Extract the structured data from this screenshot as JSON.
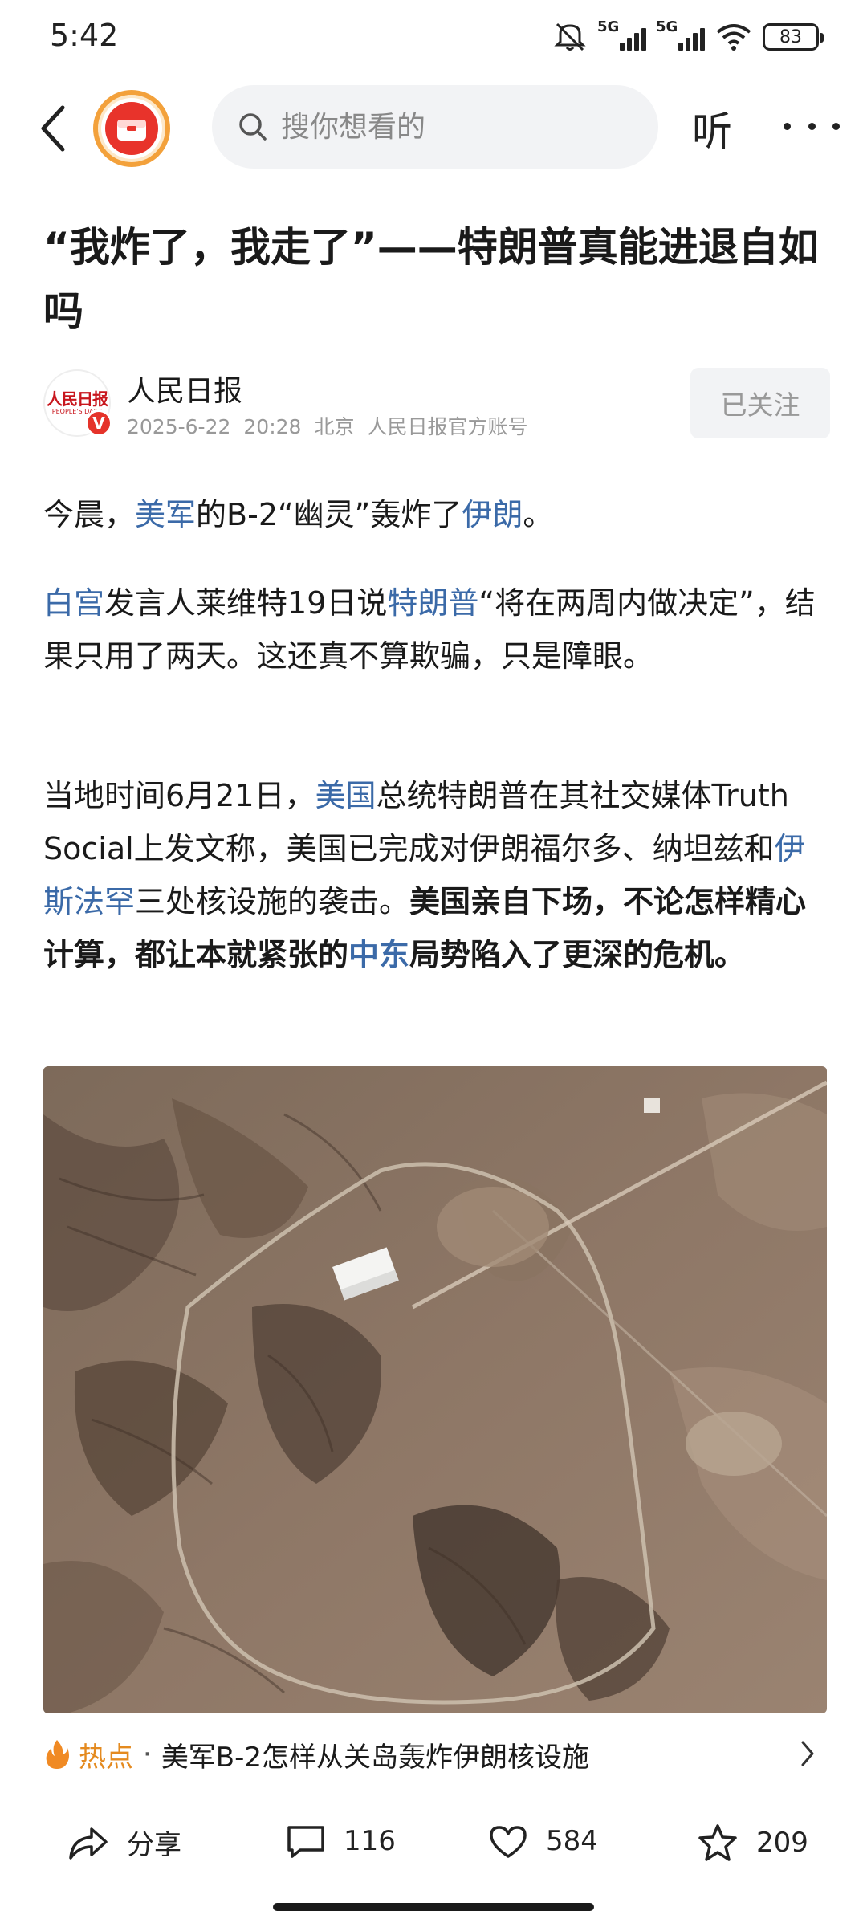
{
  "status_bar": {
    "time": "5:42",
    "network_1": "5G",
    "network_2": "5G",
    "battery": "83",
    "icons": [
      "mute-icon",
      "signal-icon",
      "signal-icon",
      "wifi-icon",
      "battery-icon"
    ]
  },
  "nav": {
    "search_placeholder": "搜你想看的",
    "listen_label": "听",
    "icons": [
      "back-icon",
      "app-logo",
      "search-icon",
      "more-icon"
    ]
  },
  "article": {
    "title": "“我炸了，我走了”——特朗普真能进退自如吗",
    "author": {
      "name": "人民日报",
      "date": "2025-6-22",
      "time": "20:28",
      "location": "北京",
      "account_type": "人民日报官方账号",
      "avatar_logo": "人民日报",
      "avatar_sub": "PEOPLE'S DAILY",
      "badge": "V",
      "follow_label": "已关注"
    },
    "p1": {
      "t1": "今晨，",
      "l1": "美军",
      "t2": "的B-2“幽灵”轰炸了",
      "l2": "伊朗",
      "t3": "。"
    },
    "p2": {
      "l1": "白宫",
      "t1": "发言人莱维特19日说",
      "l2": "特朗普",
      "t2": "“将在两周内做决定”，结果只用了两天。这还真不算欺骗，只是障眼。"
    },
    "p3": {
      "t1": "当地时间6月21日，",
      "l1": "美国",
      "t2": "总统特朗普在其社交媒体Truth Social上发文称，美国已完成对伊朗福尔多、纳坦兹和",
      "l2": "伊斯法罕",
      "t3": "三处核设施的袭击。",
      "b1": "美国亲自下场，不论怎样精心计算，都让本就紧张的",
      "l3": "中东",
      "b2": "局势陷入了更深的危机。"
    }
  },
  "hot_topic": {
    "label": "热点",
    "separator": "·",
    "text": "美军B-2怎样从关岛轰炸伊朗核设施"
  },
  "actions": {
    "share_label": "分享",
    "comment_count": "116",
    "like_count": "584",
    "favorite_count": "209"
  },
  "colors": {
    "link": "#3b6aa8",
    "hot": "#e48a1f",
    "brand_red": "#e8332b"
  }
}
